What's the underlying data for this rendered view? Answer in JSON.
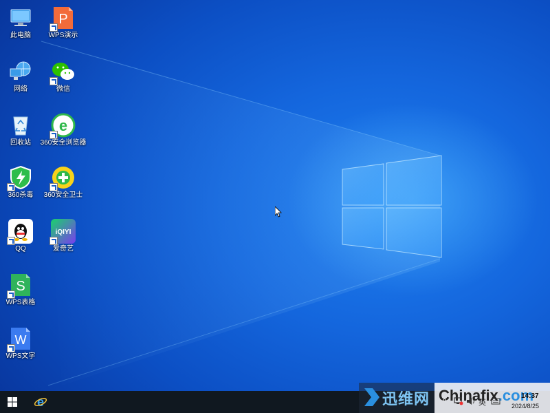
{
  "desktop_icons": [
    {
      "name": "此电脑",
      "icon": "computer-icon",
      "shortcut": false
    },
    {
      "name": "WPS演示",
      "icon": "wps-presentation-icon",
      "shortcut": true
    },
    {
      "name": "网络",
      "icon": "network-icon",
      "shortcut": false
    },
    {
      "name": "微信",
      "icon": "wechat-icon",
      "shortcut": true
    },
    {
      "name": "回收站",
      "icon": "recycle-bin-icon",
      "shortcut": false
    },
    {
      "name": "360安全浏览器",
      "icon": "360-browser-icon",
      "shortcut": true
    },
    {
      "name": "360杀毒",
      "icon": "360-antivirus-icon",
      "shortcut": true
    },
    {
      "name": "360安全卫士",
      "icon": "360-security-guard-icon",
      "shortcut": true
    },
    {
      "name": "QQ",
      "icon": "qq-icon",
      "shortcut": true
    },
    {
      "name": "爱奇艺",
      "icon": "iqiyi-icon",
      "shortcut": true
    },
    {
      "name": "WPS表格",
      "icon": "wps-spreadsheet-icon",
      "shortcut": true
    },
    {
      "name": "WPS文字",
      "icon": "wps-writer-icon",
      "shortcut": true
    }
  ],
  "iqiyi_logo_text": "iQIYI",
  "wps_p_letter": "P",
  "wps_s_letter": "S",
  "wps_w_letter": "W",
  "taskbar": {
    "start_icon": "windows-start-icon",
    "pinned": [
      "internet-explorer-icon"
    ],
    "tray": {
      "chevron": "^",
      "ime": "英",
      "time": "14:37",
      "date": "2024/8/25"
    }
  },
  "watermark": {
    "cn": "迅维网",
    "en_main": "Chinafix",
    "en_suffix": ".com"
  },
  "colors": {
    "wallpaper": "#1466dd",
    "taskbar": "#101820"
  }
}
